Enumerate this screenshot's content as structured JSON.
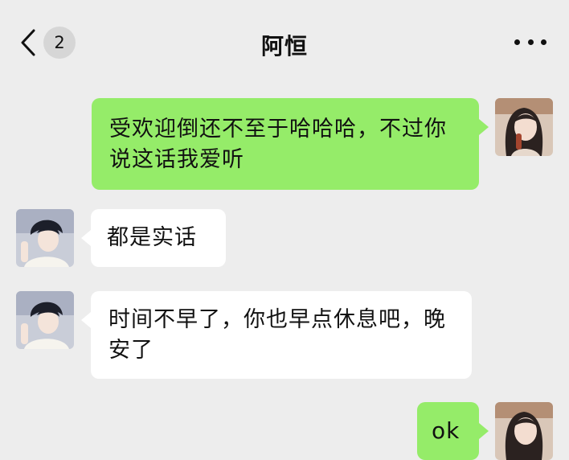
{
  "header": {
    "title": "阿恒",
    "unread_count": "2",
    "back_icon": "chevron-left-icon",
    "more_icon": "more-dots-icon"
  },
  "messages": [
    {
      "sender": "self",
      "text": "受欢迎倒还不至于哈哈哈，不过你说这话我爱听"
    },
    {
      "sender": "contact",
      "text": "都是实话"
    },
    {
      "sender": "contact",
      "text": "时间不早了，你也早点休息吧，晚安了"
    },
    {
      "sender": "self",
      "text": "ok"
    }
  ],
  "colors": {
    "background": "#ededed",
    "self_bubble": "#95ec69",
    "contact_bubble": "#ffffff"
  }
}
